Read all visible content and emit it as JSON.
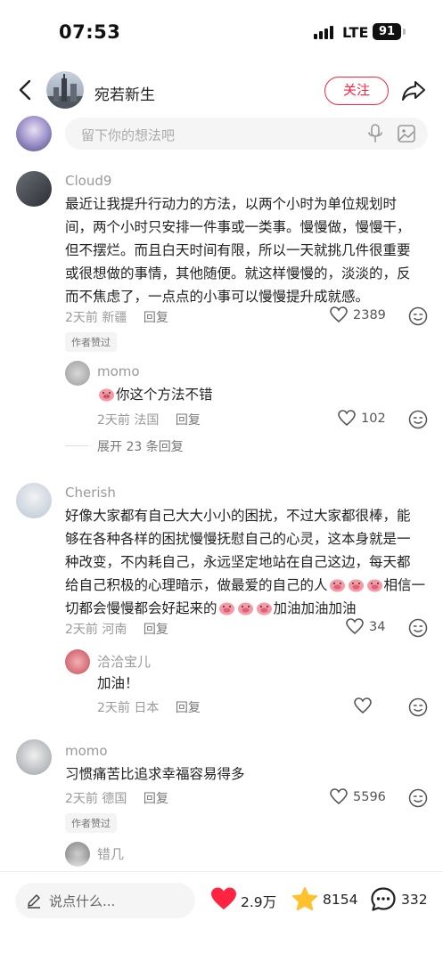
{
  "status": {
    "time": "07:53",
    "network": "LTE",
    "battery": "91"
  },
  "nav": {
    "author_name": "宛若新生",
    "follow_label": "关注"
  },
  "composer": {
    "placeholder": "留下你的想法吧"
  },
  "comments": [
    {
      "author": "Cloud9",
      "text": "最近让我提升行动力的方法，以两个小时为单位规划时间，两个小时只安排一件事或一类事。慢慢做，慢慢干，但不摆烂。而且白天时间有限，所以一天就挑几件很重要或很想做的事情，其他随便。就这样慢慢的，淡淡的，反而不焦虑了，一点点的小事可以慢慢提升成就感。",
      "time": "2天前",
      "location": "新疆",
      "reply_label": "回复",
      "likes": "2389",
      "badge": "作者赞过",
      "replies": [
        {
          "author": "momo",
          "text": "你这个方法不错",
          "time": "2天前",
          "location": "法国",
          "reply_label": "回复",
          "likes": "102"
        }
      ],
      "expand_label": "展开 23 条回复"
    },
    {
      "author": "Cherish",
      "text_lines": [
        "好像大家都有自己大大小小的困扰，不过大家都很棒，能",
        "够在各种各样的困扰慢慢抚慰自己的心灵，这本身就是一",
        "种改变，不内耗自己，永远坚定地站在自己这边，每天都",
        "给自己积极的心理暗示，做最爱的自己的人",
        "相信一",
        "切都会慢慢都会好起来的",
        "加油加油加油"
      ],
      "time": "2天前",
      "location": "河南",
      "reply_label": "回复",
      "likes": "34",
      "replies": [
        {
          "author": "洽洽宝儿",
          "text": "加油！",
          "time": "2天前",
          "location": "日本",
          "reply_label": "回复",
          "likes": ""
        }
      ]
    },
    {
      "author": "momo",
      "text": "习惯痛苦比追求幸福容易得多",
      "time": "2天前",
      "location": "德国",
      "reply_label": "回复",
      "likes": "5596",
      "badge": "作者赞过",
      "replies": [
        {
          "author": "错几",
          "text": ""
        }
      ]
    }
  ],
  "bottom_bar": {
    "input_placeholder": "说点什么...",
    "likes": "2.9万",
    "favorites": "8154",
    "comments": "332"
  },
  "colors": {
    "accent": "#ff2442",
    "star": "#ffc12e",
    "heart": "#ff2442"
  }
}
